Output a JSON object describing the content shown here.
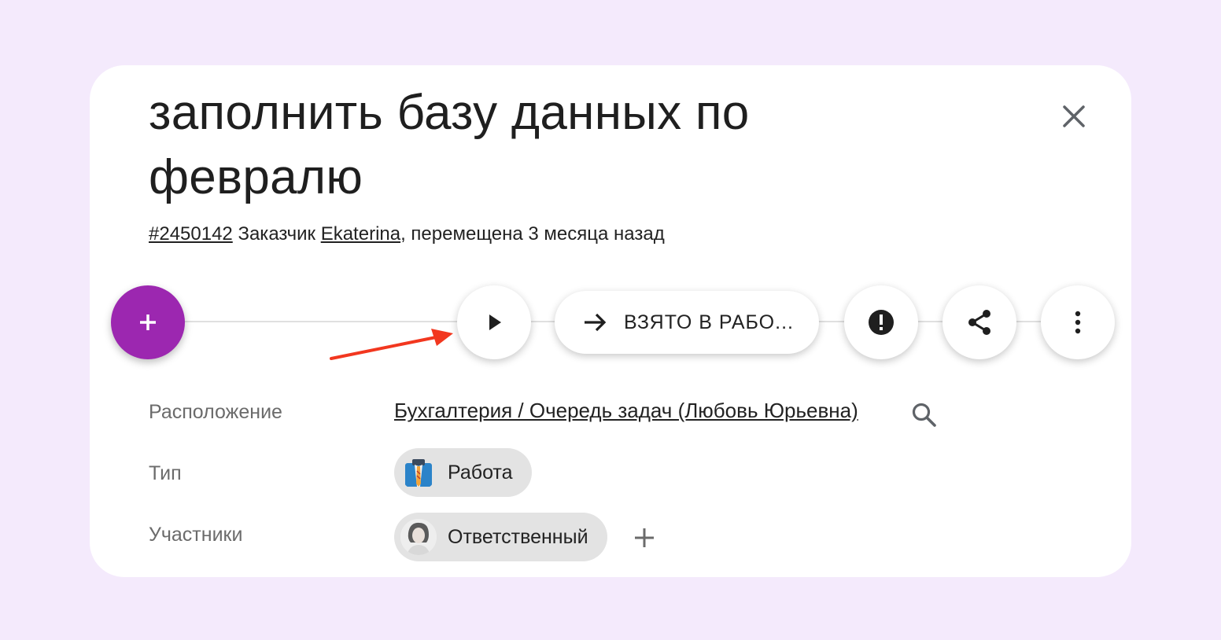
{
  "task": {
    "title": "заполнить базу данных по февралю",
    "id_link": "#2450142",
    "customer_label": "Заказчик",
    "customer_name": "Ekaterina",
    "moved_text": ", перемещена 3 месяца назад"
  },
  "toolbar": {
    "status_label": "ВЗЯТО В РАБО..."
  },
  "fields": {
    "location_label": "Расположение",
    "location_value": "Бухгалтерия / Очередь задач (Любовь Юрьевна)",
    "type_label": "Тип",
    "type_value": "Работа",
    "participants_label": "Участники",
    "participant_role": "Ответственный"
  },
  "colors": {
    "background": "#f4eafc",
    "fab": "#9c27b0",
    "annotation_arrow": "#f2371f"
  },
  "icons": [
    "close-icon",
    "plus-icon",
    "play-icon",
    "arrow-right-icon",
    "alert-icon",
    "share-icon",
    "more-vertical-icon",
    "search-icon",
    "briefcase-icon",
    "avatar"
  ]
}
